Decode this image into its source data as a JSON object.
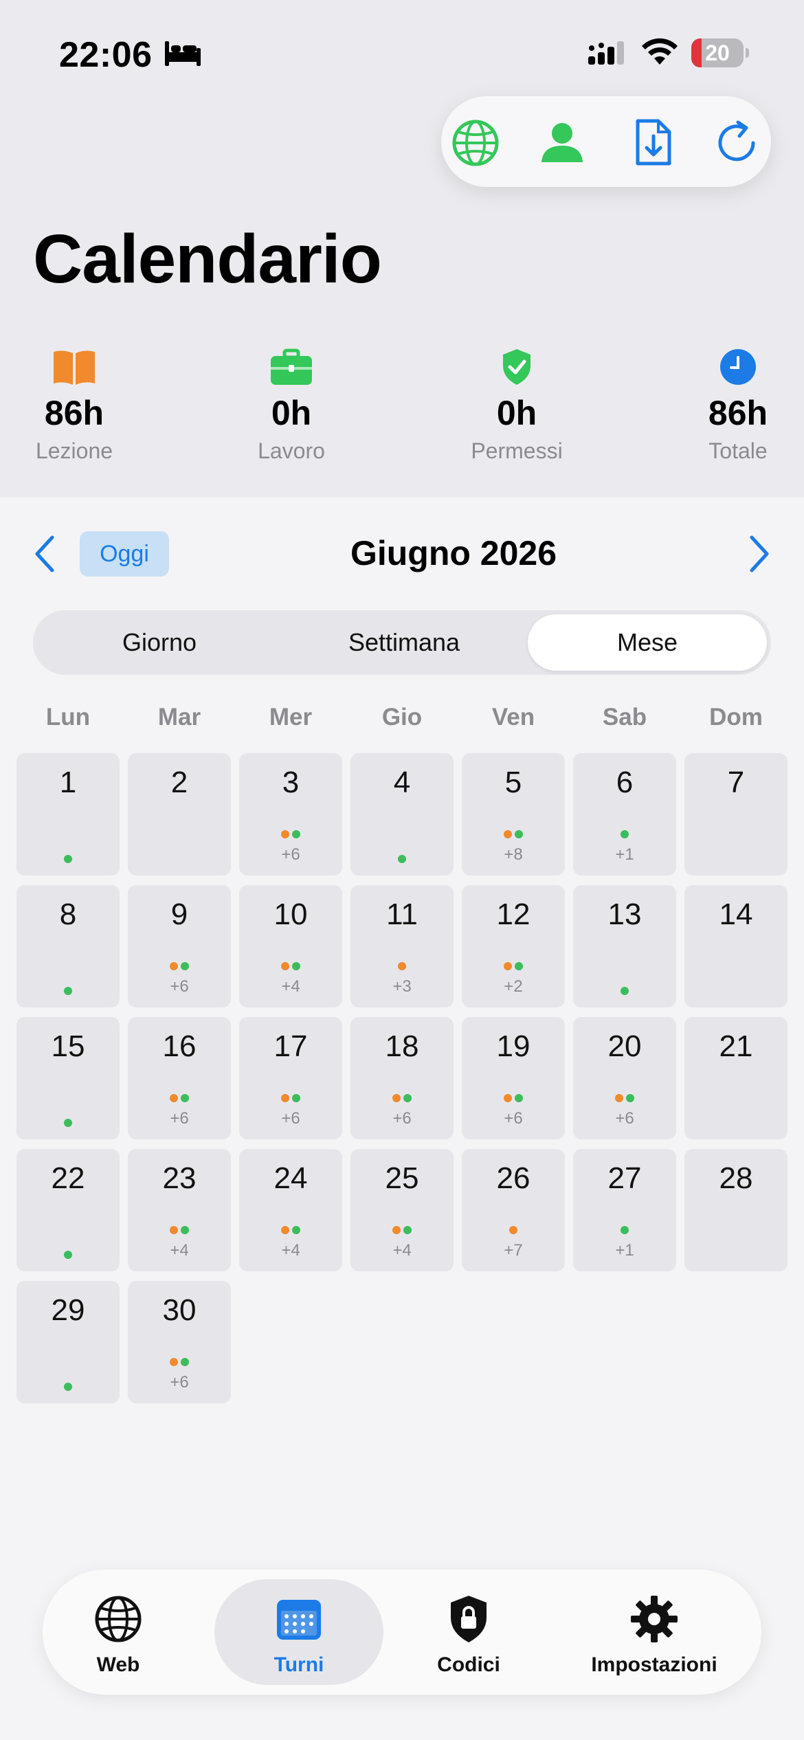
{
  "status_bar": {
    "time": "22:06",
    "battery": "20",
    "battery_level_percent": 20,
    "icons": [
      "bed-icon",
      "signal-icon",
      "wifi-icon",
      "battery-icon"
    ]
  },
  "toolbar": {
    "buttons": [
      {
        "name": "globe-icon",
        "color": "#34c759"
      },
      {
        "name": "person-icon",
        "color": "#34c759"
      },
      {
        "name": "document-download-icon",
        "color": "#1c7be6"
      },
      {
        "name": "refresh-icon",
        "color": "#1c7be6"
      }
    ]
  },
  "header": {
    "title": "Calendario"
  },
  "stats": [
    {
      "value": "86h",
      "label": "Lezione",
      "icon": "book-icon",
      "color": "#f08a2c"
    },
    {
      "value": "0h",
      "label": "Lavoro",
      "icon": "briefcase-icon",
      "color": "#34c759"
    },
    {
      "value": "0h",
      "label": "Permessi",
      "icon": "shield-check-icon",
      "color": "#34c759"
    },
    {
      "value": "86h",
      "label": "Totale",
      "icon": "clock-icon",
      "color": "#1c7be6"
    }
  ],
  "navigation": {
    "today_label": "Oggi",
    "month_title": "Giugno 2026"
  },
  "view_modes": {
    "options": [
      "Giorno",
      "Settimana",
      "Mese"
    ],
    "selected": "Mese"
  },
  "weekdays": [
    "Lun",
    "Mar",
    "Mer",
    "Gio",
    "Ven",
    "Sab",
    "Dom"
  ],
  "days": [
    {
      "n": "1",
      "dots": [],
      "single": true,
      "more": ""
    },
    {
      "n": "2",
      "dots": [],
      "single": false,
      "more": ""
    },
    {
      "n": "3",
      "dots": [
        "orange",
        "green"
      ],
      "single": false,
      "more": "+6"
    },
    {
      "n": "4",
      "dots": [],
      "single": true,
      "more": ""
    },
    {
      "n": "5",
      "dots": [
        "orange",
        "green"
      ],
      "single": false,
      "more": "+8"
    },
    {
      "n": "6",
      "dots": [
        "green"
      ],
      "single": false,
      "more": "+1"
    },
    {
      "n": "7",
      "dots": [],
      "single": false,
      "more": ""
    },
    {
      "n": "8",
      "dots": [],
      "single": true,
      "more": ""
    },
    {
      "n": "9",
      "dots": [
        "orange",
        "green"
      ],
      "single": false,
      "more": "+6"
    },
    {
      "n": "10",
      "dots": [
        "orange",
        "green"
      ],
      "single": false,
      "more": "+4"
    },
    {
      "n": "11",
      "dots": [
        "orange"
      ],
      "single": false,
      "more": "+3"
    },
    {
      "n": "12",
      "dots": [
        "orange",
        "green"
      ],
      "single": false,
      "more": "+2"
    },
    {
      "n": "13",
      "dots": [],
      "single": true,
      "more": ""
    },
    {
      "n": "14",
      "dots": [],
      "single": false,
      "more": ""
    },
    {
      "n": "15",
      "dots": [],
      "single": true,
      "more": ""
    },
    {
      "n": "16",
      "dots": [
        "orange",
        "green"
      ],
      "single": false,
      "more": "+6"
    },
    {
      "n": "17",
      "dots": [
        "orange",
        "green"
      ],
      "single": false,
      "more": "+6"
    },
    {
      "n": "18",
      "dots": [
        "orange",
        "green"
      ],
      "single": false,
      "more": "+6"
    },
    {
      "n": "19",
      "dots": [
        "orange",
        "green"
      ],
      "single": false,
      "more": "+6"
    },
    {
      "n": "20",
      "dots": [
        "orange",
        "green"
      ],
      "single": false,
      "more": "+6"
    },
    {
      "n": "21",
      "dots": [],
      "single": false,
      "more": ""
    },
    {
      "n": "22",
      "dots": [],
      "single": true,
      "more": ""
    },
    {
      "n": "23",
      "dots": [
        "orange",
        "green"
      ],
      "single": false,
      "more": "+4"
    },
    {
      "n": "24",
      "dots": [
        "orange",
        "green"
      ],
      "single": false,
      "more": "+4"
    },
    {
      "n": "25",
      "dots": [
        "orange",
        "green"
      ],
      "single": false,
      "more": "+4"
    },
    {
      "n": "26",
      "dots": [
        "orange"
      ],
      "single": false,
      "more": "+7"
    },
    {
      "n": "27",
      "dots": [
        "green"
      ],
      "single": false,
      "more": "+1"
    },
    {
      "n": "28",
      "dots": [],
      "single": false,
      "more": ""
    },
    {
      "n": "29",
      "dots": [],
      "single": true,
      "more": ""
    },
    {
      "n": "30",
      "dots": [
        "orange",
        "green"
      ],
      "single": false,
      "more": "+6"
    }
  ],
  "tabbar": {
    "tabs": [
      {
        "label": "Web",
        "icon": "globe-icon"
      },
      {
        "label": "Turni",
        "icon": "calendar-icon"
      },
      {
        "label": "Codici",
        "icon": "lock-shield-icon"
      },
      {
        "label": "Impostazioni",
        "icon": "gear-icon"
      }
    ],
    "selected": "Turni"
  }
}
